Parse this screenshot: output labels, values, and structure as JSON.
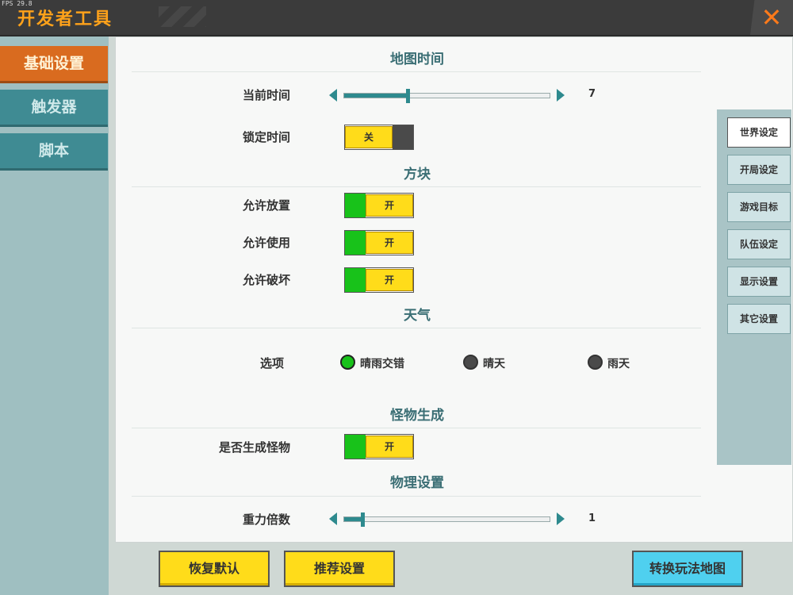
{
  "fps": "FPS 29.8",
  "title": "开发者工具",
  "close_icon": "close-icon",
  "nav": [
    "基础设置",
    "触发器",
    "脚本"
  ],
  "sections": {
    "map_time": "地图时间",
    "blocks": "方块",
    "weather": "天气",
    "monsters": "怪物生成",
    "physics": "物理设置"
  },
  "rows": {
    "current_time": {
      "label": "当前时间",
      "value": "7",
      "fraction": 0.31
    },
    "lock_time": {
      "label": "锁定时间",
      "state": "关"
    },
    "allow_place": {
      "label": "允许放置",
      "state": "开"
    },
    "allow_use": {
      "label": "允许使用",
      "state": "开"
    },
    "allow_break": {
      "label": "允许破坏",
      "state": "开"
    },
    "weather_option": {
      "label": "选项",
      "options": [
        "晴雨交错",
        "晴天",
        "雨天"
      ],
      "selected": 0
    },
    "spawn_monsters": {
      "label": "是否生成怪物",
      "state": "开"
    },
    "gravity": {
      "label": "重力倍数",
      "value": "1",
      "fraction": 0.09
    }
  },
  "right_tabs": [
    "世界设定",
    "开局设定",
    "游戏目标",
    "队伍设定",
    "显示设置",
    "其它设置"
  ],
  "buttons": {
    "restore": "恢复默认",
    "recommend": "推荐设置",
    "switch": "转换玩法地图"
  },
  "colors": {
    "accent": "#d96b1f",
    "toggle_on": "#18c21a",
    "knob": "#ffdc1a",
    "teal": "#3f8b93"
  }
}
